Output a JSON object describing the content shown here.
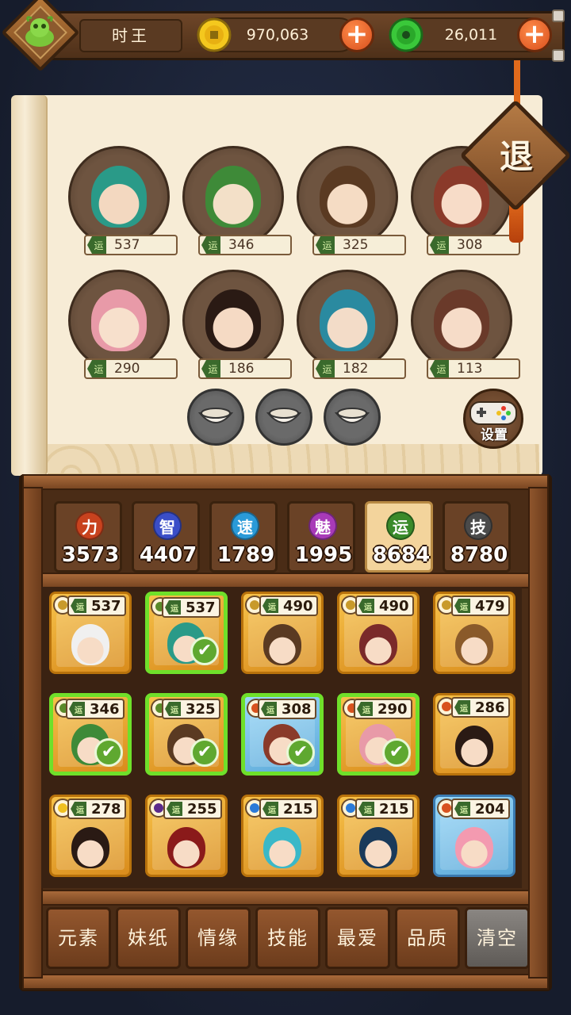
{
  "header": {
    "player_name": "时王",
    "avatar_icon": "dragon-icon",
    "gold": "970,063",
    "jade": "26,011",
    "gold_icon": "gold-coin-icon",
    "jade_icon": "jade-coin-icon",
    "plus_symbol": "+"
  },
  "scroll": {
    "exit_label": "退",
    "setting_label": "设置",
    "luck_icon_char": "运",
    "team": [
      {
        "luck": "537",
        "colors": [
          "#2a9a88",
          "#f3d8c0"
        ]
      },
      {
        "luck": "346",
        "colors": [
          "#3e8a38",
          "#f3e0c8"
        ]
      },
      {
        "luck": "325",
        "colors": [
          "#5a3a22",
          "#f5dcc4"
        ]
      },
      {
        "luck": "308",
        "colors": [
          "#8a3a2a",
          "#f7dcc8"
        ]
      },
      {
        "luck": "290",
        "colors": [
          "#e89aa8",
          "#f7e0cc"
        ]
      },
      {
        "luck": "186",
        "colors": [
          "#2a1a14",
          "#f5dac4"
        ]
      },
      {
        "luck": "182",
        "colors": [
          "#2a8aa0",
          "#f3dcc8"
        ]
      },
      {
        "luck": "113",
        "colors": [
          "#6a3a2a",
          "#f6dcc8"
        ]
      }
    ]
  },
  "stats": [
    {
      "char": "力",
      "value": "3573",
      "color": "#c8421e",
      "active": false
    },
    {
      "char": "智",
      "value": "4407",
      "color": "#3a4ec8",
      "active": false
    },
    {
      "char": "速",
      "value": "1789",
      "color": "#2a9ad8",
      "active": false
    },
    {
      "char": "魅",
      "value": "1995",
      "color": "#a83ab8",
      "active": false
    },
    {
      "char": "运",
      "value": "8684",
      "color": "#3a8a2a",
      "active": true
    },
    {
      "char": "技",
      "value": "8780",
      "color": "#4a4a4a",
      "active": false
    }
  ],
  "cards": [
    {
      "luck": "537",
      "elem": "#c89a2a",
      "selected": false,
      "skin": "gold",
      "hair": "#f0f0f0"
    },
    {
      "luck": "537",
      "elem": "#5a8a2a",
      "selected": true,
      "skin": "gold",
      "hair": "#2a9a88"
    },
    {
      "luck": "490",
      "elem": "#c89a2a",
      "selected": false,
      "skin": "gold",
      "hair": "#5a3a22"
    },
    {
      "luck": "490",
      "elem": "#c89a2a",
      "selected": false,
      "skin": "gold",
      "hair": "#7a2a2a"
    },
    {
      "luck": "479",
      "elem": "#c89a2a",
      "selected": false,
      "skin": "gold",
      "hair": "#8a5a2a"
    },
    {
      "luck": "346",
      "elem": "#5a8a2a",
      "selected": true,
      "skin": "gold",
      "hair": "#3e8a38"
    },
    {
      "luck": "325",
      "elem": "#5a8a2a",
      "selected": true,
      "skin": "gold",
      "hair": "#5a3a22"
    },
    {
      "luck": "308",
      "elem": "#d8521e",
      "selected": true,
      "skin": "blue",
      "hair": "#8a3a2a"
    },
    {
      "luck": "290",
      "elem": "#d8521e",
      "selected": true,
      "skin": "gold",
      "hair": "#e89aa8"
    },
    {
      "luck": "286",
      "elem": "#d8521e",
      "selected": false,
      "skin": "gold",
      "hair": "#2a1a14"
    },
    {
      "luck": "278",
      "elem": "#f0c020",
      "selected": false,
      "skin": "gold",
      "hair": "#2a1a14"
    },
    {
      "luck": "255",
      "elem": "#5a2a8a",
      "selected": false,
      "skin": "gold",
      "hair": "#8a1a1a"
    },
    {
      "luck": "215",
      "elem": "#2a7ad8",
      "selected": false,
      "skin": "gold",
      "hair": "#3ab8c8"
    },
    {
      "luck": "215",
      "elem": "#2a7ad8",
      "selected": false,
      "skin": "gold",
      "hair": "#1a3a5a"
    },
    {
      "luck": "204",
      "elem": "#d8521e",
      "selected": false,
      "skin": "blue",
      "hair": "#f39ab0"
    }
  ],
  "filters": [
    {
      "label": "元素",
      "name": "filter-element-button"
    },
    {
      "label": "妹纸",
      "name": "filter-girls-button"
    },
    {
      "label": "情缘",
      "name": "filter-bond-button"
    },
    {
      "label": "技能",
      "name": "filter-skill-button"
    },
    {
      "label": "最爱",
      "name": "filter-favorite-button"
    },
    {
      "label": "品质",
      "name": "filter-quality-button"
    },
    {
      "label": "清空",
      "name": "clear-button"
    }
  ],
  "check_symbol": "✔"
}
